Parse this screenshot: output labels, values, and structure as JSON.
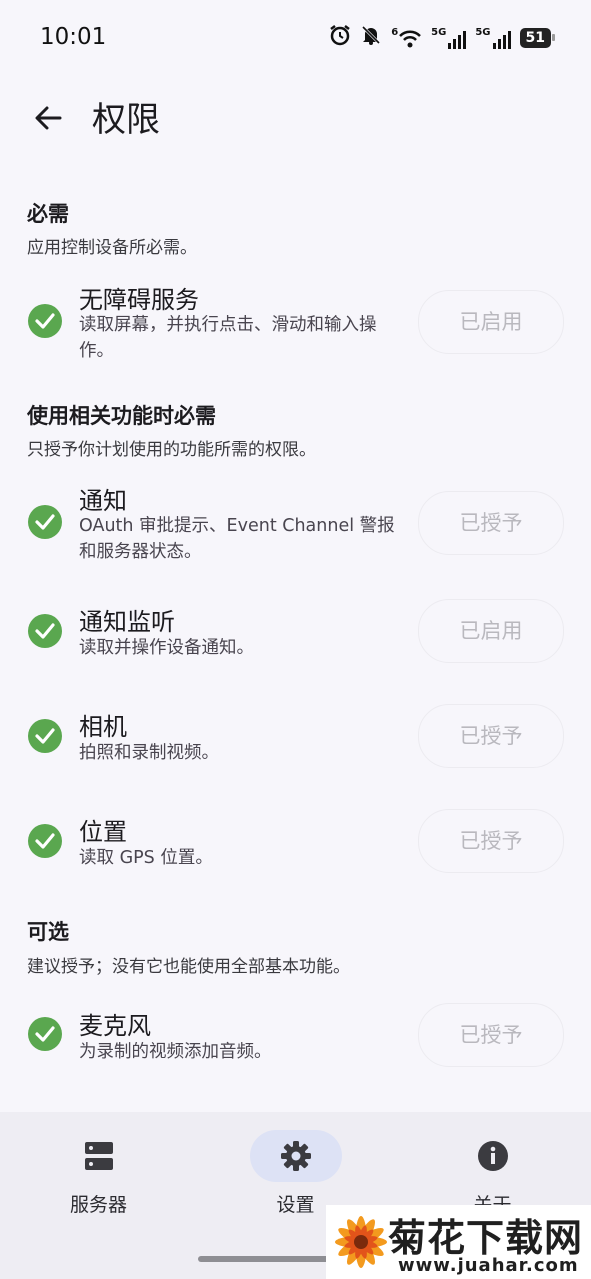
{
  "status_bar": {
    "time": "10:01",
    "signal1_label": "6",
    "net1": "5G",
    "net2": "5G",
    "battery": "51"
  },
  "header": {
    "title": "权限"
  },
  "sections": {
    "required": {
      "title": "必需",
      "subtitle": "应用控制设备所必需。"
    },
    "feature": {
      "title": "使用相关功能时必需",
      "subtitle": "只授予你计划使用的功能所需的权限。"
    },
    "optional": {
      "title": "可选",
      "subtitle": "建议授予；没有它也能使用全部基本功能。"
    }
  },
  "permissions": [
    {
      "name": "无障碍服务",
      "desc": "读取屏幕，并执行点击、滑动和输入操作。",
      "status": "已启用"
    },
    {
      "name": "通知",
      "desc": "OAuth 审批提示、Event Channel 警报和服务器状态。",
      "status": "已授予"
    },
    {
      "name": "通知监听",
      "desc": "读取并操作设备通知。",
      "status": "已启用"
    },
    {
      "name": "相机",
      "desc": "拍照和录制视频。",
      "status": "已授予"
    },
    {
      "name": "位置",
      "desc": "读取 GPS 位置。",
      "status": "已授予"
    },
    {
      "name": "麦克风",
      "desc": "为录制的视频添加音频。",
      "status": "已授予"
    }
  ],
  "bottom_nav": {
    "servers": "服务器",
    "settings": "设置",
    "about": "关于"
  },
  "watermark": {
    "title": "菊花下载网",
    "url": "www.juahar.com"
  },
  "colors": {
    "check": "#5aa74f",
    "nav_active": "#dde2f5",
    "background": "#f7f6fb"
  }
}
